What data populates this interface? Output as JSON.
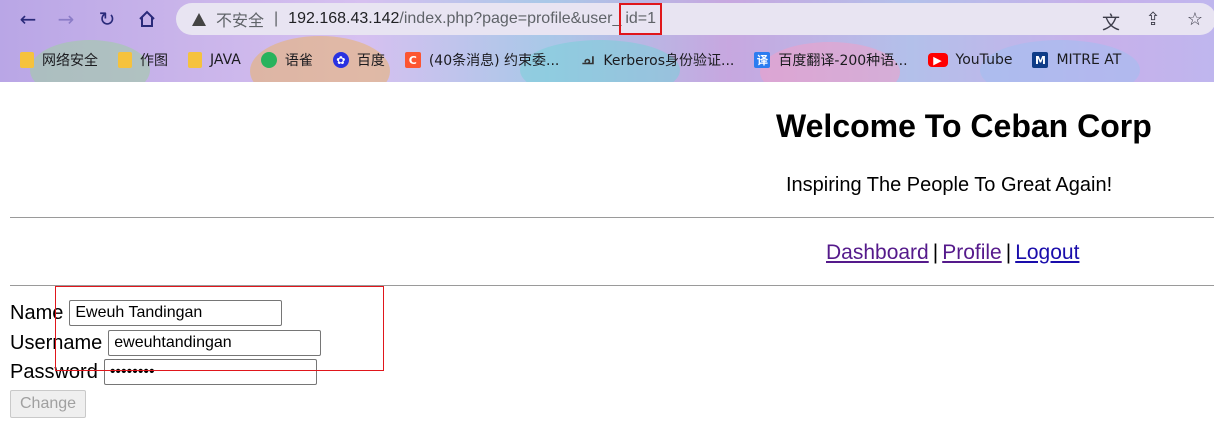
{
  "browser": {
    "nav": {
      "back_icon": "arrow-left-icon",
      "forward_icon": "arrow-right-icon",
      "reload_icon": "reload-icon",
      "home_icon": "home-icon"
    },
    "omnibox": {
      "security_label": "不安全",
      "separator": "|",
      "url_host": "192.168.43.142",
      "url_path": "/index.php?page=profile&user_",
      "url_highlight": "id=1"
    },
    "actions": [
      "translate-icon",
      "share-icon",
      "star-icon"
    ],
    "bookmarks": [
      {
        "label": "网络安全",
        "icon": "folder-icon"
      },
      {
        "label": "作图",
        "icon": "folder-icon"
      },
      {
        "label": "JAVA",
        "icon": "folder-icon"
      },
      {
        "label": "语雀",
        "icon": "yuque-icon"
      },
      {
        "label": "百度",
        "icon": "baidu-icon"
      },
      {
        "label": "(40条消息) 约束委...",
        "icon": "csdn-icon"
      },
      {
        "label": "Kerberos身份验证...",
        "icon": "kerberos-icon"
      },
      {
        "label": "百度翻译-200种语...",
        "icon": "translate-icon"
      },
      {
        "label": "YouTube",
        "icon": "youtube-icon"
      },
      {
        "label": "MITRE AT",
        "icon": "mitre-icon"
      }
    ]
  },
  "page": {
    "title": "Welcome To Ceban Corp",
    "tagline": "Inspiring The People To Great Again!",
    "nav": {
      "dashboard": "Dashboard",
      "sep1": "|",
      "profile": "Profile",
      "sep2": "|",
      "logout": "Logout"
    },
    "form": {
      "name_label": "Name",
      "name_value": "Eweuh Tandingan",
      "username_label": "Username",
      "username_value": "eweuhtandingan",
      "password_label": "Password",
      "password_value": "••••••••",
      "change_label": "Change"
    }
  },
  "colors": {
    "highlight": "#e0161b",
    "link": "#1a0dab",
    "link_visited": "#551a8b"
  }
}
